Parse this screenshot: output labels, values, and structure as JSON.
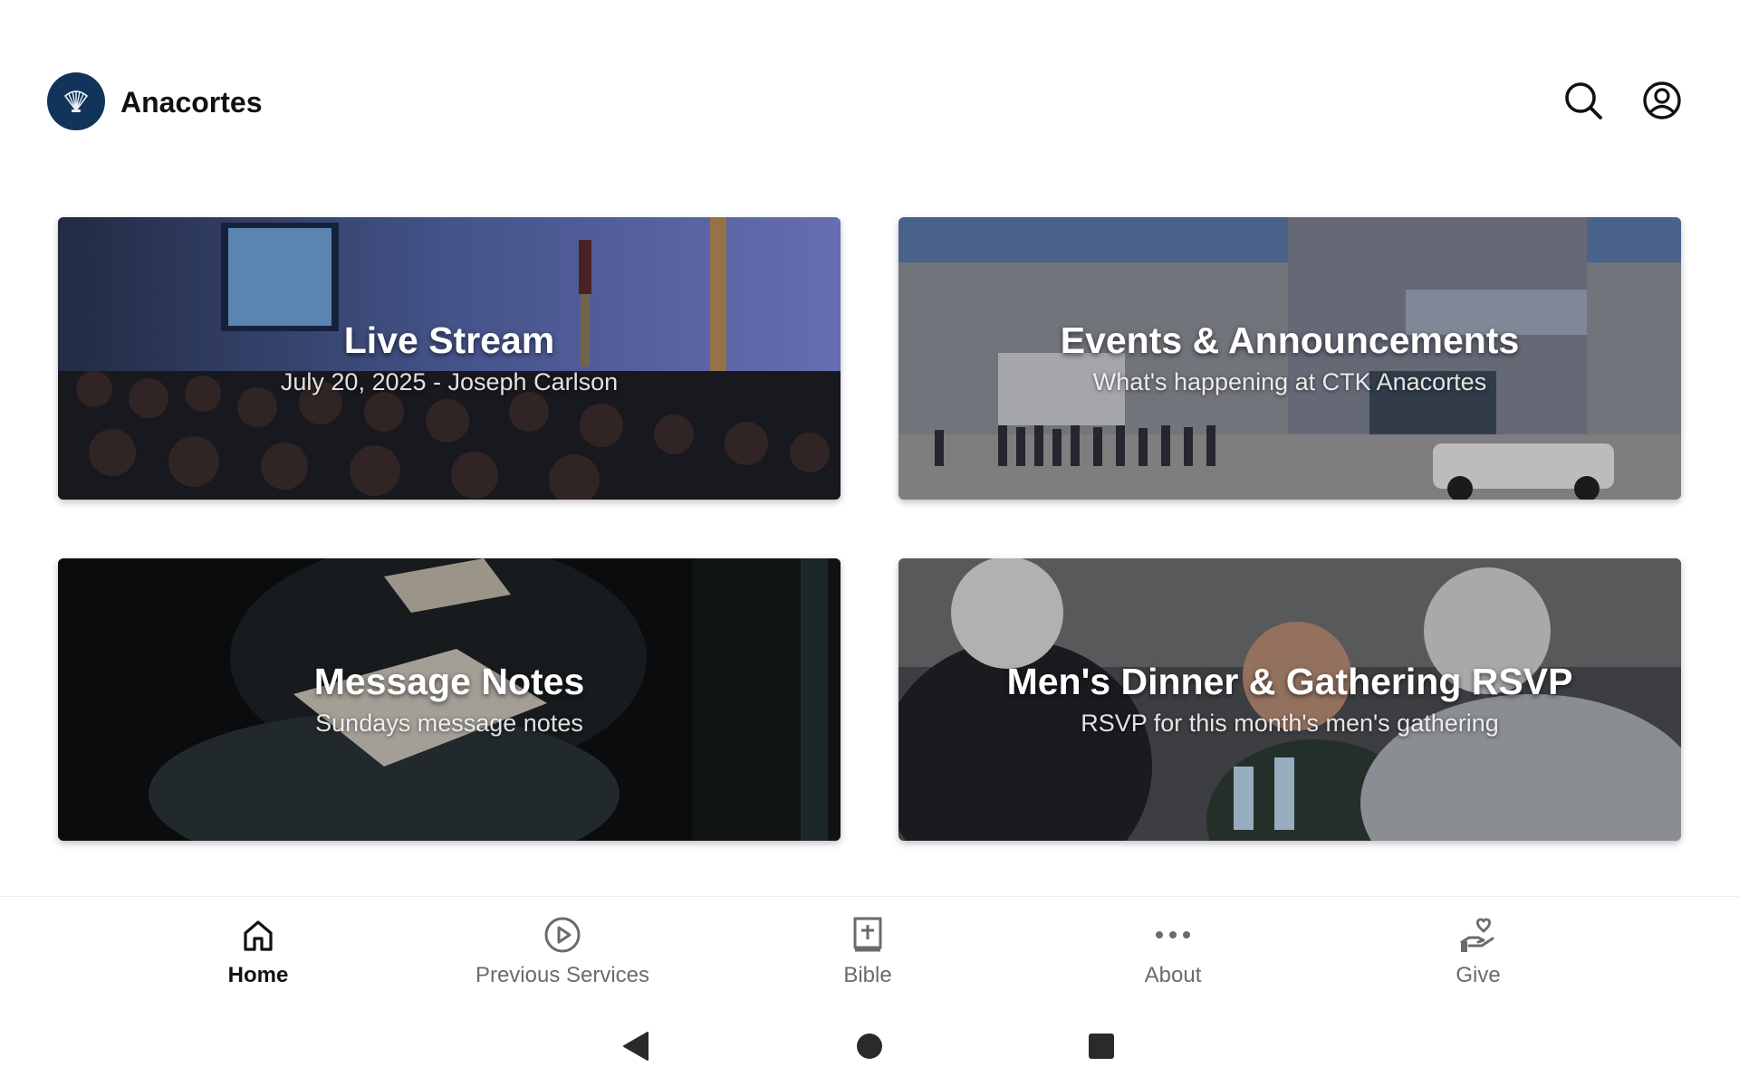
{
  "header": {
    "church_name": "Anacortes",
    "brand_color": "#12345a"
  },
  "cards": [
    {
      "title": "Live Stream",
      "subtitle": "July 20, 2025 - Joseph Carlson"
    },
    {
      "title": "Events & Announcements",
      "subtitle": "What's happening at CTK Anacortes"
    },
    {
      "title": "Message Notes",
      "subtitle": "Sundays message notes"
    },
    {
      "title": "Men's Dinner & Gathering RSVP",
      "subtitle": "RSVP for this month's men's gathering"
    }
  ],
  "nav": {
    "items": [
      {
        "label": "Home",
        "icon": "home-icon",
        "active": true
      },
      {
        "label": "Previous Services",
        "icon": "play-circle-icon",
        "active": false
      },
      {
        "label": "Bible",
        "icon": "bible-icon",
        "active": false
      },
      {
        "label": "About",
        "icon": "more-horizontal-icon",
        "active": false
      },
      {
        "label": "Give",
        "icon": "give-hand-heart-icon",
        "active": false
      }
    ]
  },
  "system_nav": [
    "back-icon",
    "home-circle-icon",
    "recents-square-icon"
  ],
  "colors": {
    "active_nav": "#111111",
    "inactive_nav": "#6b6b6b"
  }
}
